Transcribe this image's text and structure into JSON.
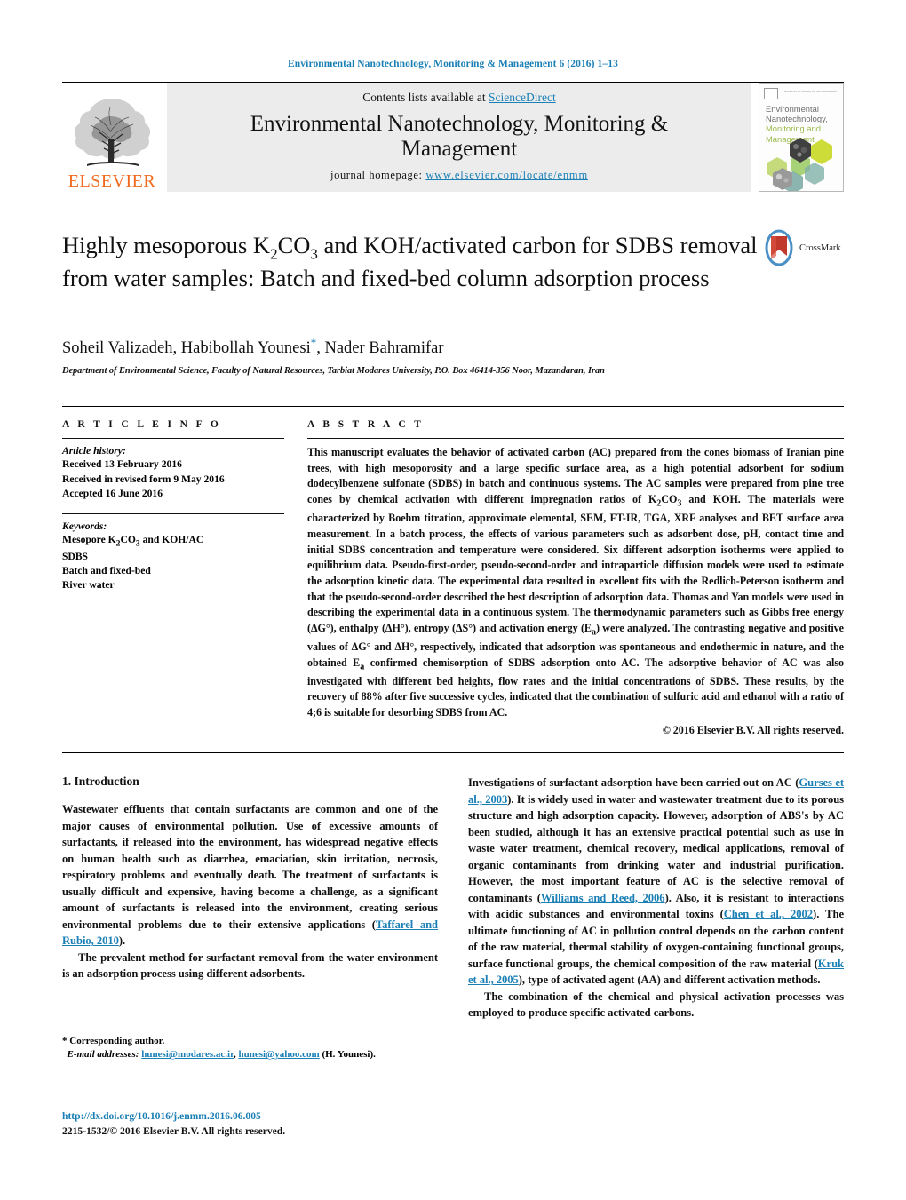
{
  "running_head": "Environmental Nanotechnology, Monitoring & Management 6 (2016) 1–13",
  "masthead": {
    "publisher": "ELSEVIER",
    "contents_prefix": "Contents lists available at ",
    "contents_link": "ScienceDirect",
    "journal_title": "Environmental Nanotechnology, Monitoring & Management",
    "homepage_label": "journal homepage:",
    "homepage_url": "www.elsevier.com/locate/enmm",
    "cover": {
      "line1": "Environmental",
      "line2": "Nanotechnology,",
      "line3": "Monitoring and",
      "line4": "Management",
      "tiny_top": "Advances in Science for the Millennium"
    }
  },
  "article": {
    "title_part1": "Highly mesoporous K",
    "title_sub1": "2",
    "title_part2": "CO",
    "title_sub2": "3",
    "title_part3": " and KOH/activated carbon for SDBS removal from water samples: Batch and fixed-bed column adsorption process",
    "crossmark_label": "CrossMark",
    "authors": "Soheil Valizadeh, Habibollah Younesi",
    "author_star": "*",
    "authors_tail": ", Nader Bahramifar",
    "affiliation": "Department of Environmental Science, Faculty of Natural Resources, Tarbiat Modares University, P.O. Box 46414-356 Noor, Mazandaran, Iran"
  },
  "article_info": {
    "heading": "A R T I C L E   I N F O",
    "history_label": "Article history:",
    "history": [
      "Received 13 February 2016",
      "Received in revised form 9 May 2016",
      "Accepted 16 June 2016"
    ],
    "keywords_label": "Keywords:",
    "keywords": [
      "Mesopore K2CO3 and KOH/AC",
      "SDBS",
      "Batch and fixed-bed",
      "River water"
    ]
  },
  "abstract": {
    "heading": "A B S T R A C T",
    "text": "This manuscript evaluates the behavior of activated carbon (AC) prepared from the cones biomass of Iranian pine trees, with high mesoporosity and a large specific surface area, as a high potential adsorbent for sodium dodecylbenzene sulfonate (SDBS) in batch and continuous systems. The AC samples were prepared from pine tree cones by chemical activation with different impregnation ratios of K2CO3 and KOH. The materials were characterized by Boehm titration, approximate elemental, SEM, FT-IR, TGA, XRF analyses and BET surface area measurement. In a batch process, the effects of various parameters such as adsorbent dose, pH, contact time and initial SDBS concentration and temperature were considered. Six different adsorption isotherms were applied to equilibrium data. Pseudo-first-order, pseudo-second-order and intraparticle diffusion models were used to estimate the adsorption kinetic data. The experimental data resulted in excellent fits with the Redlich-Peterson isotherm and that the pseudo-second-order described the best description of adsorption data. Thomas and Yan models were used in describing the experimental data in a continuous system. The thermodynamic parameters such as Gibbs free energy (ΔG°), enthalpy (ΔH°), entropy (ΔS°) and activation energy (Ea) were analyzed. The contrasting negative and positive values of ΔG° and ΔH°, respectively, indicated that adsorption was spontaneous and endothermic in nature, and the obtained Ea confirmed chemisorption of SDBS adsorption onto AC. The adsorptive behavior of AC was also investigated with different bed heights, flow rates and the initial concentrations of SDBS. These results, by the recovery of 88% after five successive cycles, indicated that the combination of sulfuric acid and ethanol with a ratio of 4;6 is suitable for desorbing SDBS from AC.",
    "copyright": "© 2016 Elsevier B.V. All rights reserved."
  },
  "body": {
    "section_heading": "1. Introduction",
    "left_p1": "Wastewater effluents that contain surfactants are common and one of the major causes of environmental pollution. Use of excessive amounts of surfactants, if released into the environment, has widespread negative effects on human health such as diarrhea, emaciation, skin irritation, necrosis, respiratory problems and eventually death. The treatment of surfactants is usually difficult and expensive, having become a challenge, as a significant amount of surfactants is released into the environment, creating serious environmental problems due to their extensive applications (",
    "left_p1_cite": "Taffarel and Rubio, 2010",
    "left_p1_end": ").",
    "left_p2": "The prevalent method for surfactant removal from the water environment is an adsorption process using different adsorbents.",
    "right_p1_a": "Investigations of surfactant adsorption have been carried out on AC (",
    "right_cite1": "Gurses et al., 2003",
    "right_p1_b": "). It is widely used in water and wastewater treatment due to its porous structure and high adsorption capacity. However, adsorption of ABS's by AC been studied, although it has an extensive practical potential such as use in waste water treatment, chemical recovery, medical applications, removal of organic contaminants from drinking water and industrial purification. However, the most important feature of AC is the selective removal of contaminants (",
    "right_cite2": "Williams and Reed, 2006",
    "right_p1_c": "). Also, it is resistant to interactions with acidic substances and environmental toxins (",
    "right_cite3": "Chen et al., 2002",
    "right_p1_d": "). The ultimate functioning of AC in pollution control depends on the carbon content of the raw material, thermal stability of oxygen-containing functional groups, surface functional groups, the chemical composition of the raw material (",
    "right_cite4": "Kruk et al., 2005",
    "right_p1_e": "), type of activated agent (AA) and different activation methods.",
    "right_p2": "The combination of the chemical and physical activation processes was employed to produce specific activated carbons."
  },
  "footnote": {
    "corresponding": "* Corresponding author.",
    "email_label": "E-mail addresses:",
    "email1": "hunesi@modares.ac.ir",
    "email_sep": ", ",
    "email2": "hunesi@yahoo.com",
    "email_suffix": " (H. Younesi)."
  },
  "doi": {
    "url": "http://dx.doi.org/10.1016/j.enmm.2016.06.005",
    "issn": "2215-1532/© 2016 Elsevier B.V. All rights reserved."
  },
  "colors": {
    "link": "#1a7fb5",
    "elsevier_orange": "#f06a1e",
    "band_gray": "#ececec"
  }
}
